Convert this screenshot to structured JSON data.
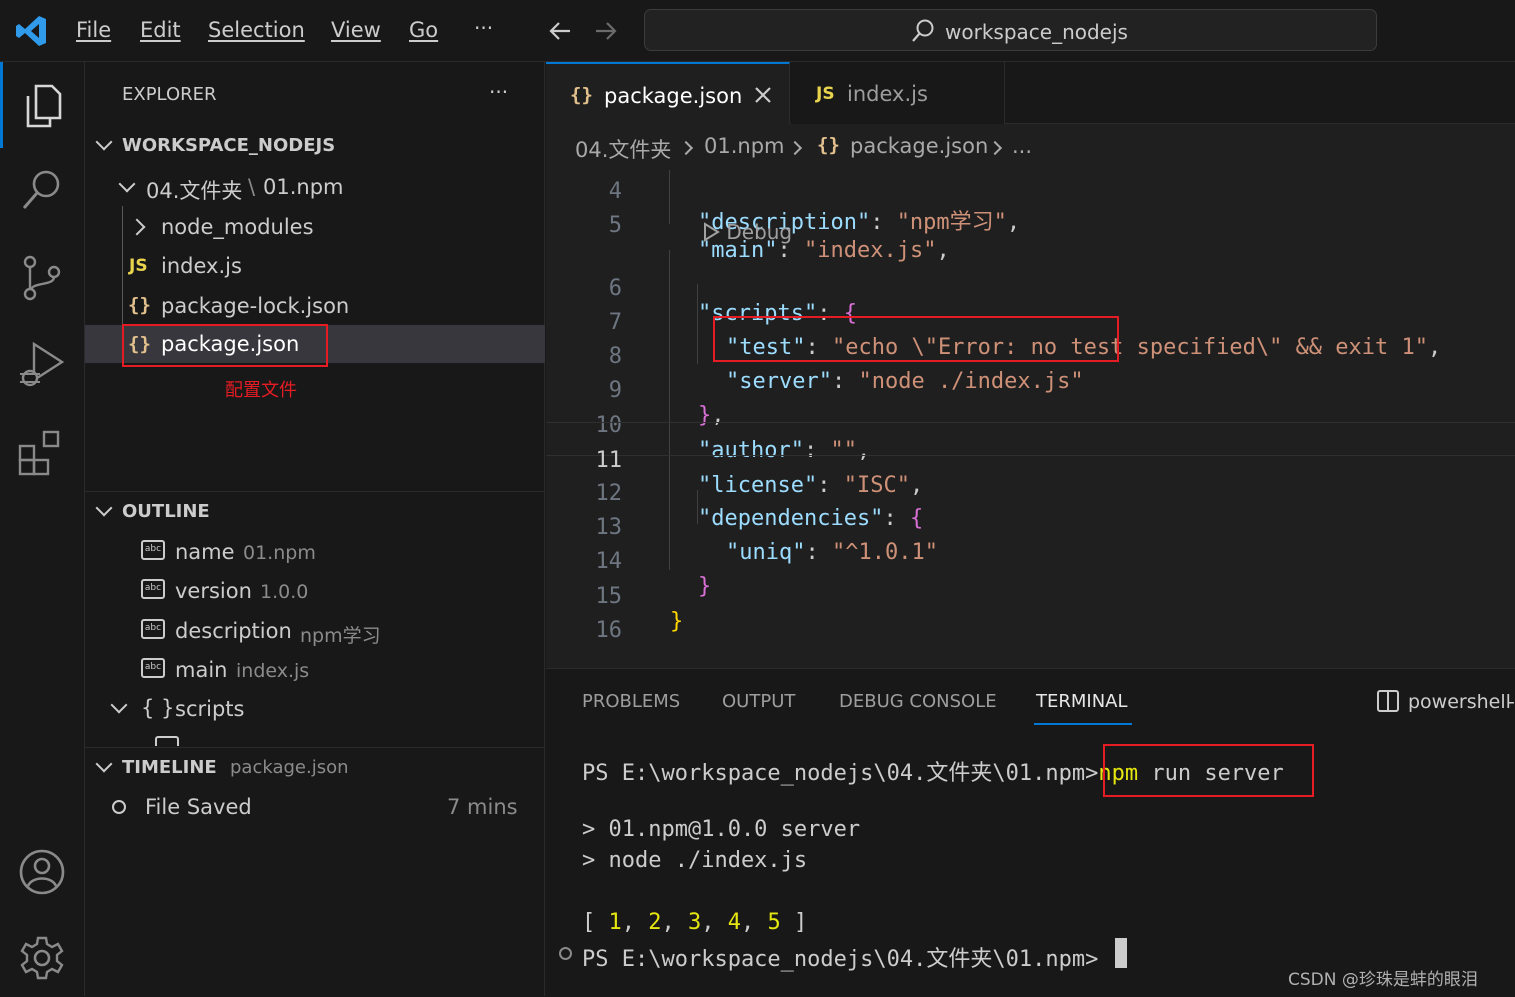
{
  "titlebar": {
    "menu": [
      "File",
      "Edit",
      "Selection",
      "View",
      "Go"
    ],
    "more": "···",
    "search": "workspace_nodejs"
  },
  "sidebar": {
    "explorer_title": "EXPLORER",
    "more": "···",
    "workspace": "WORKSPACE_NODEJS",
    "folder": "04.文件夹",
    "folder_sep": "\\",
    "subfolder": "01.npm",
    "items": [
      {
        "label": "node_modules",
        "icon": "chevron-right-icon"
      },
      {
        "label": "index.js",
        "icon": "js-file-icon",
        "icon_text": "JS"
      },
      {
        "label": "package-lock.json",
        "icon": "json-file-icon",
        "icon_text": "{}"
      },
      {
        "label": "package.json",
        "icon": "json-file-icon",
        "icon_text": "{}"
      }
    ],
    "annotation": "配置文件",
    "outline": {
      "title": "OUTLINE",
      "items": [
        {
          "key": "name",
          "value": "01.npm"
        },
        {
          "key": "version",
          "value": "1.0.0"
        },
        {
          "key": "description",
          "value": "npm学习"
        },
        {
          "key": "main",
          "value": "index.js"
        }
      ],
      "scripts_icon": "{ }",
      "scripts_label": "scripts",
      "abc": "abc"
    },
    "timeline": {
      "title": "TIMELINE",
      "file": "package.json",
      "entry": "File Saved",
      "time": "7 mins"
    }
  },
  "editor": {
    "tabs": [
      {
        "label": "package.json",
        "icon_text": "{}",
        "active": true
      },
      {
        "label": "index.js",
        "icon_text": "JS",
        "active": false
      }
    ],
    "breadcrumb": [
      "04.文件夹",
      "01.npm",
      "package.json",
      "..."
    ],
    "breadcrumb_icon": "{}",
    "debug_lens": "Debug",
    "lines": {
      "n4": "4",
      "n5": "5",
      "n6": "6",
      "n7": "7",
      "n8": "8",
      "n9": "9",
      "n10": "10",
      "n11": "11",
      "n12": "12",
      "n13": "13",
      "n14": "14",
      "n15": "15",
      "n16": "16",
      "l4k": "\"description\"",
      "l4s": "\"npm学习\"",
      "l5k": "\"main\"",
      "l5s": "\"index.js\"",
      "l6k": "\"scripts\"",
      "l7k": "\"test\"",
      "l7s": "\"echo \\\"Error: no test specified\\\" && exit 1\"",
      "l8k": "\"server\"",
      "l8s": "\"node ./index.js\"",
      "l10k": "\"author\"",
      "l10s": "\"\"",
      "l11k": "\"license\"",
      "l11s": "\"ISC\"",
      "l12k": "\"dependencies\"",
      "l13k": "\"uniq\"",
      "l13s": "\"^1.0.1\""
    }
  },
  "panel": {
    "tabs": [
      "PROBLEMS",
      "OUTPUT",
      "DEBUG CONSOLE",
      "TERMINAL"
    ],
    "shell": "powershell",
    "terminal": {
      "prompt": "PS E:\\workspace_nodejs\\04.文件夹\\01.npm>",
      "cmd_npm": "npm",
      "cmd_rest": " run server",
      "out1": "> 01.npm@1.0.0 server",
      "out2": "> node ./index.js",
      "arr_open": "[ ",
      "arr_nums": [
        "1",
        "2",
        "3",
        "4",
        "5"
      ],
      "arr_close": " ]",
      "prompt2": "PS E:\\workspace_nodejs\\04.文件夹\\01.npm>"
    }
  },
  "watermark": "CSDN @珍珠是蚌的眼泪"
}
